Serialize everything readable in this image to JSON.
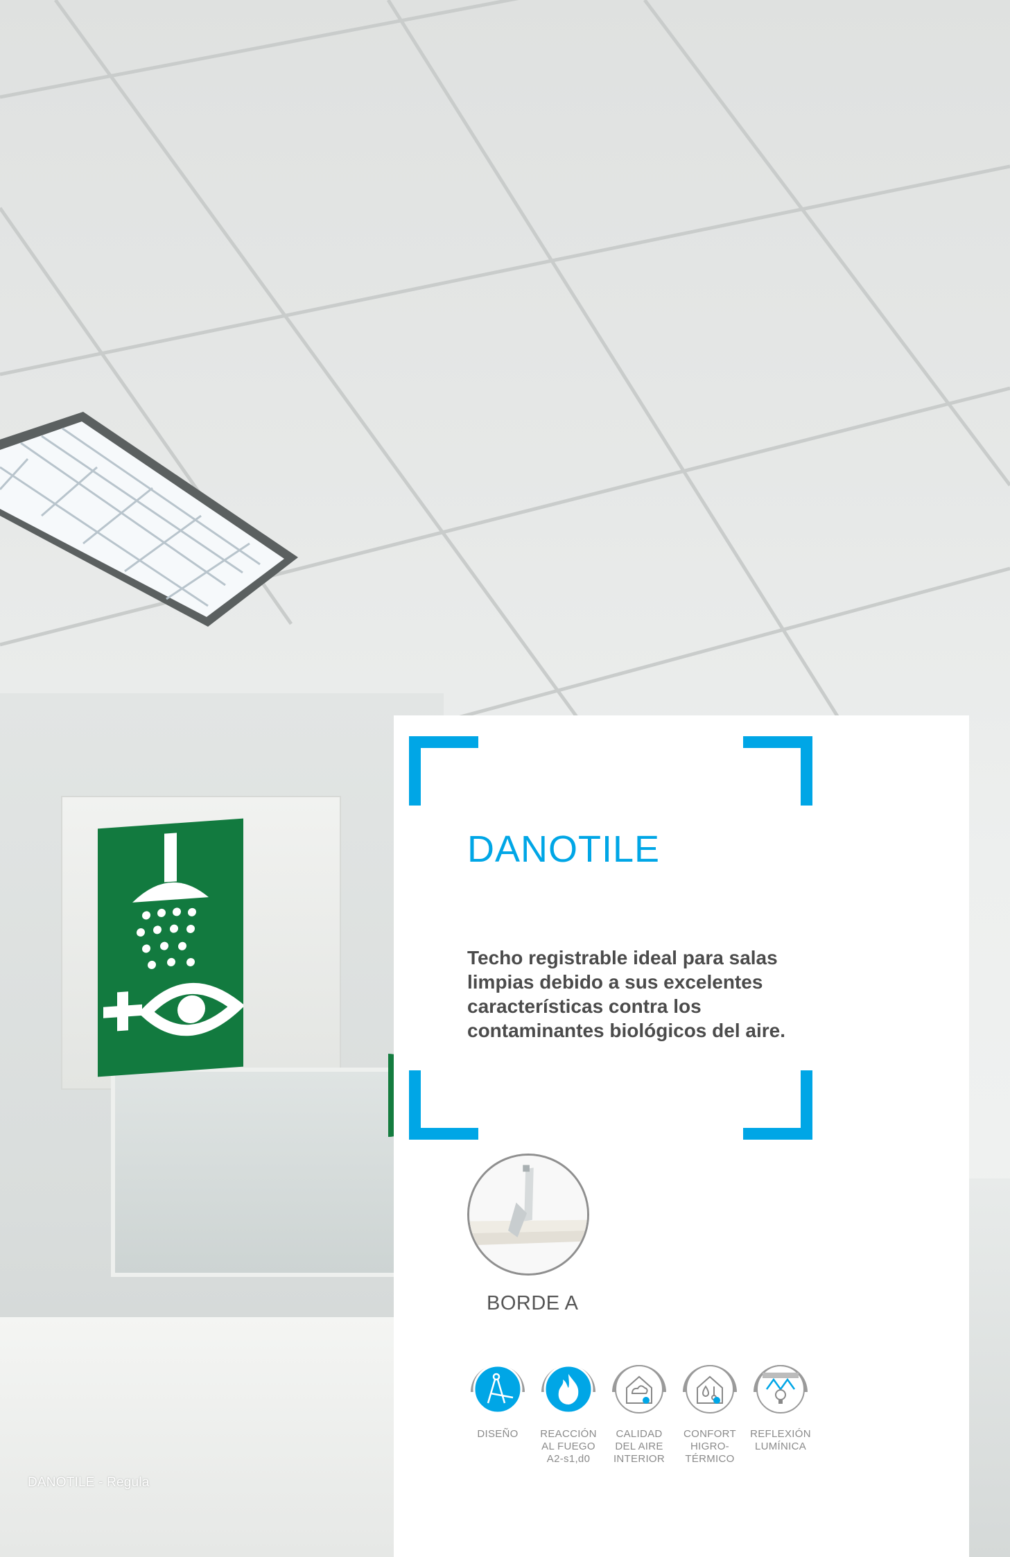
{
  "caption": "DANOTILE - Regula",
  "card": {
    "title": "DANOTILE",
    "description": "Techo registrable ideal para salas limpias debido a sus excelentes características contra los contaminantes biológicos del aire.",
    "edge_label": "BORDE A"
  },
  "features": [
    {
      "icon": "compass-icon",
      "lines": [
        "DISEÑO"
      ]
    },
    {
      "icon": "flame-icon",
      "lines": [
        "REACCIÓN",
        "AL FUEGO",
        "A2-s1,d0"
      ]
    },
    {
      "icon": "air-quality-house-icon",
      "lines": [
        "CALIDAD",
        "DEL AIRE",
        "INTERIOR"
      ]
    },
    {
      "icon": "hygrothermal-house-icon",
      "lines": [
        "CONFORT",
        "HIGRO-",
        "TÉRMICO"
      ]
    },
    {
      "icon": "light-reflection-icon",
      "lines": [
        "REFLEXIÓN",
        "LUMÍNICA"
      ]
    }
  ],
  "colors": {
    "accent": "#00a6e6",
    "text_dark": "#4b4b4b",
    "icon_ring": "#9a9a9a",
    "sign_green": "#127a3f"
  }
}
